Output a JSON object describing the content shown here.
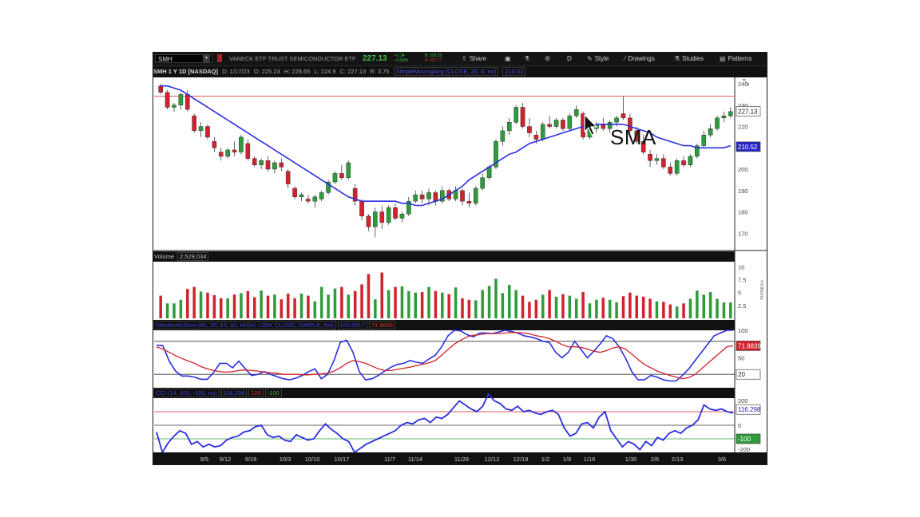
{
  "toolbar": {
    "symbol": "SMH",
    "description": "VANECK ETF TRUST SEMICONDUCTOR ETF",
    "last": "227.13",
    "change_lines": [
      "+1.34",
      "+0.59%"
    ],
    "bid_ask_lines": [
      "B: 226.20",
      "A: 227.77"
    ],
    "share_label": "Share",
    "period_label": "D",
    "style_label": "Style",
    "drawings_label": "Drawings",
    "studies_label": "Studies",
    "patterns_label": "Patterns"
  },
  "info": {
    "title": "SMH 1 Y 1D [NASDAQ]",
    "date": "D: 1/17/23",
    "open": "O: 225.23",
    "high": "H: 228.65",
    "low": "L: 224.9",
    "close": "C: 227.13",
    "range": "R: 3.75",
    "sma_title": "SimpleMovingAvg (CLOSE, 20, 0, no)",
    "sma_value": "210.52"
  },
  "panels": {
    "volume_label": "Volume",
    "volume_value": "2,529,034",
    "stoch_label": "StochasticSlow (80, 20, 10, 10, HIGH, LOW, CLOSE, SIMPLE, No)",
    "stoch_k": "100.0017",
    "stoch_d": "71.8839",
    "cci_label": "CCI (14, 100, -100, no)",
    "cci_value": "116.298",
    "cci_over": "100",
    "cci_under": "-100"
  },
  "overlay": {
    "label": "SMA"
  },
  "colors": {
    "up": "#2f9b3c",
    "down": "#d0232d",
    "sma": "#2b2ee0",
    "resistance": "#d34b4b",
    "stoch_k": "#2b2ee0",
    "stoch_d": "#d0232d",
    "cci": "#2b2ee0",
    "cci_zero": "#333333",
    "cci_over": "#d0232d",
    "cci_under": "#2f9b3c",
    "last_tag": "#ffffff",
    "sma_tag": "#2727c8"
  },
  "chart_data": [
    {
      "type": "candlestick",
      "title": "SMH 1 Y 1D [NASDAQ]",
      "ylim": [
        163,
        243
      ],
      "y_ticks": [
        "240",
        "230",
        "220",
        "210",
        "200",
        "190",
        "180",
        "170"
      ],
      "x_ticks": [
        "9/5",
        "9/12",
        "9/19",
        "10/3",
        "10/10",
        "10/17",
        "11/7",
        "11/14",
        "11/28",
        "12/12",
        "12/19",
        "1/2",
        "1/9",
        "1/16",
        "1/30",
        "2/6",
        "2/13",
        "3/6"
      ],
      "resistance_level": 234.2,
      "last_price": "227.13",
      "sma_last": "210.52",
      "ohlc": [
        [
          239,
          240,
          235,
          236
        ],
        [
          236,
          237,
          228,
          229
        ],
        [
          229,
          231,
          227,
          230
        ],
        [
          230,
          236,
          228,
          235
        ],
        [
          235,
          237,
          227,
          228
        ],
        [
          225,
          226,
          217,
          218
        ],
        [
          218,
          222,
          215,
          220
        ],
        [
          220,
          221,
          214,
          215
        ],
        [
          213,
          215,
          208,
          210
        ],
        [
          208,
          210,
          204,
          206
        ],
        [
          206,
          210,
          205,
          209
        ],
        [
          209,
          213,
          206,
          208
        ],
        [
          208,
          216,
          207,
          215
        ],
        [
          212,
          214,
          204,
          205
        ],
        [
          205,
          206,
          201,
          202
        ],
        [
          202,
          205,
          200,
          204
        ],
        [
          204,
          206,
          199,
          200
        ],
        [
          200,
          204,
          198,
          203
        ],
        [
          203,
          205,
          199,
          201
        ],
        [
          199,
          200,
          191,
          193
        ],
        [
          191,
          192,
          186,
          187
        ],
        [
          187,
          189,
          185,
          188
        ],
        [
          186,
          188,
          184,
          185
        ],
        [
          185,
          188,
          182,
          187
        ],
        [
          186,
          190,
          185,
          189
        ],
        [
          189,
          195,
          188,
          194
        ],
        [
          194,
          199,
          193,
          198
        ],
        [
          198,
          202,
          195,
          196
        ],
        [
          196,
          204,
          195,
          203
        ],
        [
          191,
          193,
          183,
          185
        ],
        [
          185,
          186,
          176,
          178
        ],
        [
          178,
          179,
          171,
          173
        ],
        [
          173,
          182,
          168,
          180
        ],
        [
          180,
          183,
          172,
          175
        ],
        [
          175,
          183,
          174,
          182
        ],
        [
          182,
          184,
          176,
          177
        ],
        [
          177,
          180,
          175,
          179
        ],
        [
          179,
          187,
          178,
          185
        ],
        [
          185,
          190,
          184,
          188
        ],
        [
          188,
          190,
          184,
          186
        ],
        [
          186,
          191,
          183,
          189
        ],
        [
          189,
          190,
          183,
          185
        ],
        [
          185,
          192,
          184,
          190
        ],
        [
          190,
          191,
          185,
          186
        ],
        [
          186,
          192,
          185,
          190
        ],
        [
          190,
          191,
          183,
          185
        ],
        [
          185,
          189,
          182,
          184
        ],
        [
          184,
          192,
          183,
          191
        ],
        [
          191,
          198,
          190,
          196
        ],
        [
          196,
          202,
          195,
          201
        ],
        [
          201,
          214,
          200,
          213
        ],
        [
          213,
          220,
          211,
          218
        ],
        [
          218,
          224,
          216,
          222
        ],
        [
          222,
          230,
          221,
          229
        ],
        [
          229,
          231,
          219,
          220
        ],
        [
          220,
          224,
          215,
          217
        ],
        [
          216,
          218,
          212,
          214
        ],
        [
          214,
          222,
          213,
          221
        ],
        [
          221,
          225,
          219,
          220
        ],
        [
          220,
          224,
          219,
          223
        ],
        [
          223,
          224,
          218,
          219
        ],
        [
          219,
          226,
          218,
          225
        ],
        [
          225,
          230,
          224,
          228
        ],
        [
          226,
          227,
          214,
          215
        ],
        [
          215,
          220,
          214,
          219
        ],
        [
          219,
          222,
          217,
          221
        ],
        [
          221,
          224,
          218,
          219
        ],
        [
          219,
          223,
          217,
          222
        ],
        [
          222,
          225,
          220,
          224
        ],
        [
          226,
          234,
          223,
          224
        ],
        [
          224,
          226,
          217,
          218
        ],
        [
          218,
          220,
          212,
          213
        ],
        [
          213,
          216,
          207,
          208
        ],
        [
          207,
          209,
          201,
          204
        ],
        [
          204,
          207,
          202,
          205
        ],
        [
          205,
          207,
          200,
          201
        ],
        [
          201,
          203,
          197,
          198
        ],
        [
          198,
          205,
          197,
          204
        ],
        [
          204,
          206,
          201,
          202
        ],
        [
          202,
          207,
          201,
          206
        ],
        [
          206,
          212,
          205,
          211
        ],
        [
          211,
          218,
          210,
          216
        ],
        [
          216,
          221,
          215,
          219
        ],
        [
          219,
          225,
          218,
          224
        ],
        [
          224,
          227,
          222,
          225
        ],
        [
          225,
          229,
          224,
          227
        ]
      ],
      "sma": [
        239,
        239,
        238,
        237,
        235,
        233,
        231,
        229,
        227,
        225,
        223,
        221,
        219,
        217,
        215,
        213,
        211,
        209,
        207,
        205,
        203,
        201,
        199,
        197,
        195,
        193,
        191,
        189,
        187,
        186,
        185,
        185,
        185,
        185,
        185,
        185,
        184,
        184,
        183,
        183,
        184,
        185,
        186,
        188,
        190,
        192,
        195,
        197,
        199,
        201,
        203,
        205,
        207,
        208,
        210,
        212,
        213,
        214,
        215,
        216,
        217,
        218,
        219,
        220,
        220,
        221,
        221,
        221,
        221,
        221,
        220,
        219,
        218,
        217,
        215,
        214,
        213,
        212,
        211,
        211,
        210,
        210,
        210,
        210,
        210,
        211
      ]
    },
    {
      "type": "bar",
      "title": "Volume",
      "ylabel": "millions",
      "ylim": [
        0,
        11
      ],
      "y_ticks": [
        "10",
        "7.5",
        "5",
        "2.5"
      ],
      "values": [
        4.4,
        2.9,
        2.9,
        3.6,
        5.7,
        6.1,
        5.2,
        5.0,
        4.5,
        3.9,
        3.9,
        4.6,
        4.9,
        5.3,
        4.1,
        5.4,
        4.4,
        4.6,
        3.7,
        4.8,
        3.9,
        4.8,
        4.4,
        3.3,
        6.1,
        4.6,
        5.8,
        6.1,
        4.6,
        5.3,
        6.6,
        8.6,
        3.7,
        8.9,
        5.5,
        6.1,
        6.2,
        5.3,
        5.0,
        5.1,
        6.1,
        5.3,
        5.0,
        4.7,
        6.0,
        3.9,
        3.6,
        3.5,
        5.5,
        6.3,
        7.7,
        4.9,
        6.5,
        5.5,
        4.4,
        3.2,
        3.6,
        4.6,
        5.5,
        4.2,
        4.7,
        4.4,
        3.8,
        5.1,
        2.9,
        3.6,
        4.0,
        3.6,
        3.1,
        4.3,
        5.0,
        4.4,
        4.2,
        3.8,
        3.3,
        3.2,
        2.7,
        2.3,
        2.9,
        3.8,
        5.4,
        4.6,
        5.1,
        3.8,
        3.1,
        3.1
      ],
      "up": [
        false,
        true,
        true,
        true,
        false,
        false,
        true,
        false,
        false,
        false,
        true,
        false,
        true,
        false,
        false,
        true,
        false,
        true,
        false,
        false,
        false,
        true,
        false,
        true,
        true,
        true,
        true,
        false,
        true,
        false,
        false,
        false,
        true,
        false,
        true,
        false,
        true,
        true,
        true,
        false,
        true,
        false,
        true,
        false,
        true,
        false,
        false,
        true,
        true,
        true,
        true,
        true,
        true,
        true,
        false,
        false,
        false,
        true,
        false,
        true,
        false,
        true,
        true,
        false,
        true,
        true,
        false,
        true,
        true,
        false,
        false,
        false,
        false,
        false,
        true,
        false,
        false,
        true,
        false,
        true,
        true,
        true,
        true,
        true,
        true,
        true
      ]
    },
    {
      "type": "line",
      "title": "StochasticSlow (80, 20, 10, 10, HIGH, LOW, CLOSE, SIMPLE, No)",
      "ylim": [
        0,
        100
      ],
      "levels": [
        80,
        20
      ],
      "y_ticks": [
        "100",
        "50",
        "20"
      ],
      "series": [
        {
          "name": "100.0017",
          "values": [
            73,
            72,
            44,
            26,
            17,
            17,
            15,
            11,
            11,
            23,
            40,
            40,
            32,
            44,
            30,
            18,
            20,
            25,
            20,
            16,
            12,
            10,
            13,
            18,
            25,
            30,
            12,
            20,
            45,
            78,
            82,
            60,
            25,
            10,
            12,
            18,
            26,
            33,
            38,
            40,
            45,
            42,
            40,
            48,
            55,
            70,
            90,
            100,
            99,
            92,
            88,
            95,
            95,
            94,
            97,
            100,
            98,
            95,
            90,
            88,
            85,
            80,
            78,
            60,
            50,
            60,
            80,
            65,
            50,
            62,
            75,
            90,
            85,
            70,
            50,
            25,
            10,
            10,
            18,
            15,
            10,
            8,
            8,
            18,
            30,
            45,
            60,
            75,
            90,
            95,
            100,
            100
          ]
        },
        {
          "name": "71.8839",
          "values": [
            70,
            66,
            60,
            54,
            49,
            44,
            40,
            34,
            30,
            27,
            25,
            24,
            25,
            27,
            28,
            27,
            26,
            24,
            23,
            22,
            20,
            20,
            20,
            19,
            19,
            20,
            21,
            22,
            26,
            32,
            40,
            45,
            43,
            40,
            35,
            30,
            27,
            27,
            29,
            31,
            33,
            36,
            38,
            41,
            45,
            55,
            65,
            75,
            82,
            88,
            91,
            92,
            94,
            94,
            94,
            95,
            96,
            96,
            95,
            93,
            90,
            88,
            85,
            80,
            74,
            70,
            70,
            69,
            66,
            62,
            60,
            63,
            68,
            70,
            66,
            57,
            47,
            38,
            32,
            26,
            22,
            18,
            15,
            12,
            14,
            20,
            30,
            40,
            50,
            60,
            70,
            72
          ]
        }
      ]
    },
    {
      "type": "line",
      "title": "CCI (14, 100, -100, no)",
      "ylim": [
        -200,
        200
      ],
      "levels": [
        100,
        0,
        -100
      ],
      "y_ticks": [
        "200",
        "0",
        "-100",
        "-200"
      ],
      "series": [
        {
          "name": "116.298",
          "values": [
            -50,
            -200,
            -130,
            -80,
            -40,
            -60,
            -140,
            -120,
            -160,
            -140,
            -160,
            -150,
            -110,
            -90,
            -80,
            -50,
            -40,
            -10,
            0,
            -70,
            -90,
            -80,
            -110,
            -120,
            -70,
            -90,
            -110,
            -100,
            -40,
            10,
            -30,
            -60,
            -100,
            -120,
            -200,
            -170,
            -140,
            -120,
            -100,
            -80,
            -60,
            -40,
            0,
            20,
            10,
            40,
            50,
            20,
            60,
            50,
            80,
            130,
            180,
            150,
            120,
            100,
            140,
            230,
            180,
            160,
            120,
            110,
            140,
            100,
            110,
            90,
            80,
            100,
            110,
            80,
            -20,
            -80,
            -60,
            10,
            20,
            -20,
            60,
            100,
            -40,
            -100,
            -160,
            -120,
            -140,
            -180,
            -120,
            -150,
            -90,
            -110,
            -60,
            -40,
            -60,
            -20,
            0,
            40,
            150,
            120,
            110,
            120,
            100,
            90
          ]
        }
      ]
    }
  ]
}
